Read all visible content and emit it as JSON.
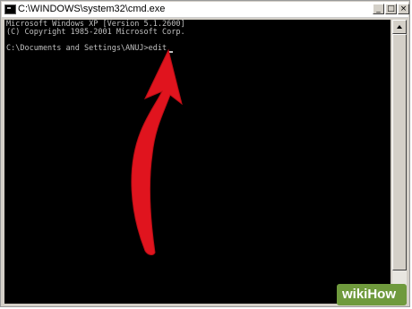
{
  "window": {
    "title": "C:\\WINDOWS\\system32\\cmd.exe",
    "buttons": {
      "minimize": "_",
      "maximize": "□",
      "close": "×"
    }
  },
  "console": {
    "lines": [
      "Microsoft Windows XP [Version 5.1.2600]",
      "(C) Copyright 1985-2001 Microsoft Corp."
    ],
    "prompt": "C:\\Documents and Settings\\ANUJ>edit",
    "text_color": "#c0c0c0",
    "background_color": "#000000"
  },
  "annotation": {
    "icon": "red-arrow-icon",
    "color": "#e0141e"
  },
  "watermark": {
    "logo_text": "wikiHow",
    "color": "#6f9a3d"
  }
}
